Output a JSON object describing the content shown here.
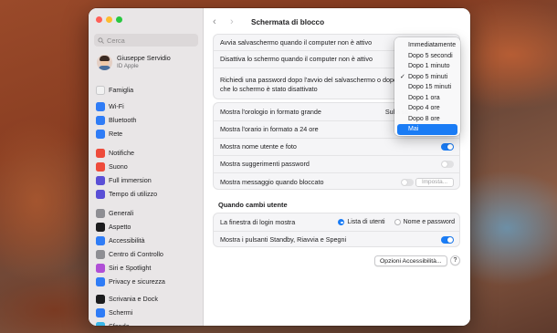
{
  "window": {
    "search_placeholder": "Cerca",
    "page_title": "Schermata di blocco"
  },
  "profile": {
    "name": "Giuseppe Servidio",
    "subtitle": "ID Apple"
  },
  "sidebar": {
    "items": [
      {
        "label": "Famiglia",
        "icon": "family-icon",
        "color": "#f2f2f2"
      },
      {
        "label": "Wi-Fi",
        "icon": "wifi-icon",
        "color": "#2f7cf6"
      },
      {
        "label": "Bluetooth",
        "icon": "bluetooth-icon",
        "color": "#2f7cf6"
      },
      {
        "label": "Rete",
        "icon": "network-icon",
        "color": "#2f7cf6"
      },
      {
        "label": "Notifiche",
        "icon": "bell-icon",
        "color": "#ee4b3b"
      },
      {
        "label": "Suono",
        "icon": "speaker-icon",
        "color": "#ee4b3b"
      },
      {
        "label": "Full immersion",
        "icon": "moon-icon",
        "color": "#5a4fd6"
      },
      {
        "label": "Tempo di utilizzo",
        "icon": "hourglass-icon",
        "color": "#5a4fd6"
      },
      {
        "label": "Generali",
        "icon": "gear-icon",
        "color": "#8e8e93"
      },
      {
        "label": "Aspetto",
        "icon": "appearance-icon",
        "color": "#1c1c1e"
      },
      {
        "label": "Accessibilità",
        "icon": "accessibility-icon",
        "color": "#2f7cf6"
      },
      {
        "label": "Centro di Controllo",
        "icon": "control-center-icon",
        "color": "#8e8e93"
      },
      {
        "label": "Siri e Spotlight",
        "icon": "siri-icon",
        "color": "#b04fd6"
      },
      {
        "label": "Privacy e sicurezza",
        "icon": "hand-icon",
        "color": "#2f7cf6"
      },
      {
        "label": "Scrivania e Dock",
        "icon": "dock-icon",
        "color": "#1c1c1e"
      },
      {
        "label": "Schermi",
        "icon": "display-icon",
        "color": "#2f7cf6"
      },
      {
        "label": "Sfondo",
        "icon": "wallpaper-icon",
        "color": "#38b6e8"
      }
    ]
  },
  "settings": {
    "screensaver_label": "Avvia salvaschermo quando il computer non è attivo",
    "display_off_label": "Disattiva lo schermo quando il computer non è attivo",
    "password_label_line1": "Richiedi una password dopo l'avvio del salvaschermo o dopo",
    "password_label_line2": "che lo schermo è stato disattivato",
    "large_clock_label": "Mostra l'orologio in formato grande",
    "large_clock_value": "Sulla sc",
    "clock_24h_label": "Mostra l'orario in formato a 24 ore",
    "show_username_label": "Mostra nome utente e foto",
    "show_username_on": true,
    "password_hints_label": "Mostra suggerimenti password",
    "password_hints_on": false,
    "message_label": "Mostra messaggio quando bloccato",
    "message_on": false,
    "message_button": "Imposta..."
  },
  "user_switch": {
    "section_title": "Quando cambi utente",
    "login_window_label": "La finestra di login mostra",
    "option_list": "Lista di utenti",
    "option_name": "Nome e password",
    "selected": "option_list",
    "buttons_label": "Mostra i pulsanti Standby, Riavvia e Spegni",
    "buttons_on": true
  },
  "footer": {
    "accessibility_button": "Opzioni Accessibilità...",
    "help_button": "?"
  },
  "dropdown": {
    "items": [
      {
        "label": "Immediatamente",
        "checked": false,
        "highlighted": false
      },
      {
        "label": "Dopo 5 secondi",
        "checked": false,
        "highlighted": false
      },
      {
        "label": "Dopo 1 minuto",
        "checked": false,
        "highlighted": false
      },
      {
        "label": "Dopo 5 minuti",
        "checked": true,
        "highlighted": false
      },
      {
        "label": "Dopo 15 minuti",
        "checked": false,
        "highlighted": false
      },
      {
        "label": "Dopo 1 ora",
        "checked": false,
        "highlighted": false
      },
      {
        "label": "Dopo 4 ore",
        "checked": false,
        "highlighted": false
      },
      {
        "label": "Dopo 8 ore",
        "checked": false,
        "highlighted": false
      },
      {
        "label": "Mai",
        "checked": false,
        "highlighted": true
      }
    ],
    "check_glyph": "✓"
  },
  "colors": {
    "accent": "#1a7cf5",
    "close": "#ff5f57",
    "minimize": "#febc2e",
    "zoom": "#28c840"
  }
}
